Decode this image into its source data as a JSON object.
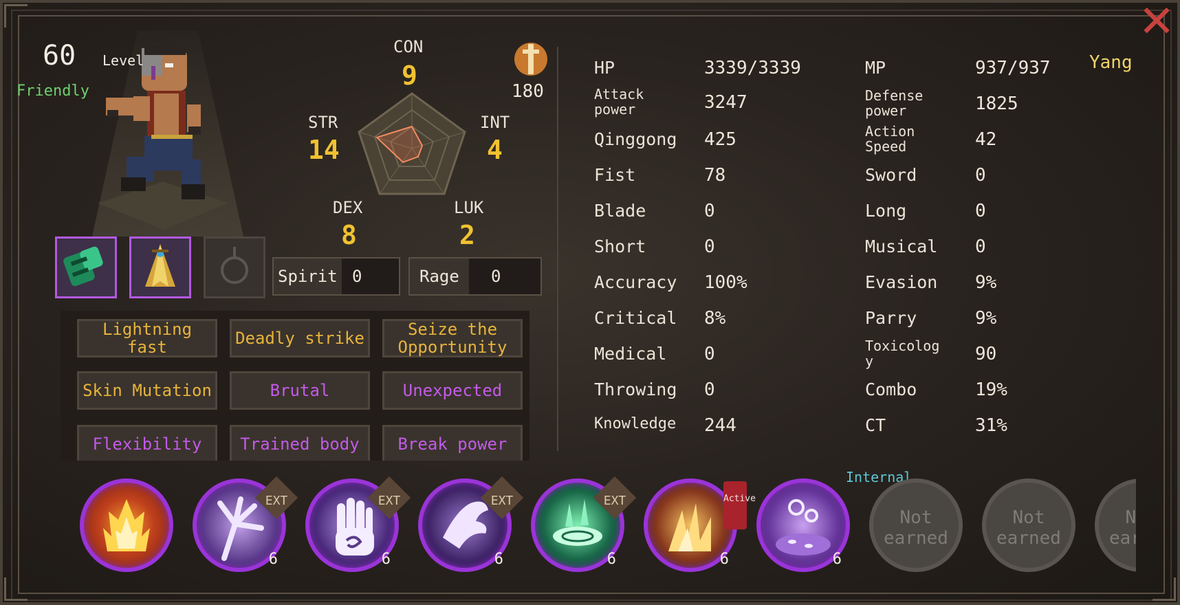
{
  "character": {
    "level_number": "60",
    "level_label": "Level",
    "attitude": "Friendly",
    "name": "Yang"
  },
  "attributes": {
    "con": {
      "label": "CON",
      "value": "9"
    },
    "str": {
      "label": "STR",
      "value": "14"
    },
    "int": {
      "label": "INT",
      "value": "4"
    },
    "dex": {
      "label": "DEX",
      "value": "8"
    },
    "luk": {
      "label": "LUK",
      "value": "2"
    },
    "points": "180"
  },
  "resources": {
    "spirit_label": "Spirit",
    "spirit_value": "0",
    "rage_label": "Rage",
    "rage_value": "0"
  },
  "equipment": [
    {
      "name": "bracer-icon",
      "state": "equipped"
    },
    {
      "name": "cloak-icon",
      "state": "equipped"
    },
    {
      "name": "accessory-slot-icon",
      "state": "empty"
    }
  ],
  "traits": [
    {
      "label": "Lightning fast",
      "color": "#e6b43c"
    },
    {
      "label": "Deadly strike",
      "color": "#e6b43c"
    },
    {
      "label": "Seize the Opportunity",
      "color": "#e6b43c"
    },
    {
      "label": "Skin Mutation",
      "color": "#e6b43c"
    },
    {
      "label": "Brutal",
      "color": "#c35ae8"
    },
    {
      "label": "Unexpected",
      "color": "#c35ae8"
    },
    {
      "label": "Flexibility",
      "color": "#c35ae8"
    },
    {
      "label": "Trained body",
      "color": "#c35ae8"
    },
    {
      "label": "Break power",
      "color": "#c35ae8"
    }
  ],
  "stats_left": [
    {
      "label": "HP",
      "value": "3339/3339"
    },
    {
      "label": "Attack power",
      "value": "3247"
    },
    {
      "label": "Qinggong",
      "value": "425"
    },
    {
      "label": "Fist",
      "value": "78"
    },
    {
      "label": "Blade",
      "value": "0"
    },
    {
      "label": "Short",
      "value": "0"
    },
    {
      "label": "Accuracy",
      "value": "100%"
    },
    {
      "label": "Critical",
      "value": "8%"
    },
    {
      "label": "Medical",
      "value": "0"
    },
    {
      "label": "Throwing",
      "value": "0"
    },
    {
      "label": "Knowledge",
      "value": "244"
    }
  ],
  "stats_right": [
    {
      "label": "MP",
      "value": "937/937"
    },
    {
      "label": "Defense power",
      "value": "1825"
    },
    {
      "label": "Action Speed",
      "value": "42"
    },
    {
      "label": "Sword",
      "value": "0"
    },
    {
      "label": "Long",
      "value": "0"
    },
    {
      "label": "Musical",
      "value": "0"
    },
    {
      "label": "Evasion",
      "value": "9%"
    },
    {
      "label": "Parry",
      "value": "9%"
    },
    {
      "label": "Toxicology",
      "value": "90"
    },
    {
      "label": "Combo",
      "value": "19%"
    },
    {
      "label": "CT",
      "value": "31%"
    }
  ],
  "skills": [
    {
      "icon": "fire-aura-skill-icon",
      "tag": "",
      "level": "",
      "state": "learned"
    },
    {
      "icon": "claw-strike-skill-icon",
      "tag": "EXT",
      "level": "6",
      "state": "learned"
    },
    {
      "icon": "palm-strike-skill-icon",
      "tag": "EXT",
      "level": "6",
      "state": "learned"
    },
    {
      "icon": "spirit-hand-skill-icon",
      "tag": "EXT",
      "level": "6",
      "state": "learned"
    },
    {
      "icon": "green-vortex-skill-icon",
      "tag": "EXT",
      "level": "6",
      "state": "learned"
    },
    {
      "icon": "flame-burst-skill-icon",
      "tag": "Active",
      "level": "6",
      "state": "learned"
    },
    {
      "icon": "bubble-skill-icon",
      "tag": "Internal",
      "level": "6",
      "state": "learned"
    },
    {
      "label": "Not earned",
      "state": "empty"
    },
    {
      "label": "Not earned",
      "state": "empty"
    },
    {
      "label": "Not earned",
      "state": "empty"
    }
  ],
  "colors": {
    "gold": "#f0c230",
    "purple_border": "#9a34d8",
    "friendly_green": "#6fcf6f",
    "close_red": "#c8423e"
  }
}
